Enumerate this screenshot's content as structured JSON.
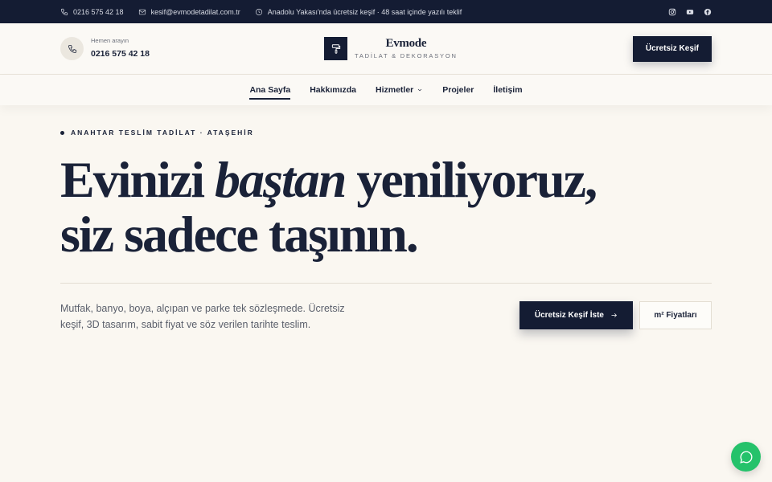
{
  "topbar": {
    "phone": "0216 575 42 18",
    "email": "kesif@evmodetadilat.com.tr",
    "notice": "Anadolu Yakası'nda ücretsiz keşif · 48 saat içinde yazılı teklif",
    "socials": [
      "instagram-icon",
      "youtube-icon",
      "facebook-icon"
    ]
  },
  "header": {
    "call_label": "Hemen arayın",
    "call_phone": "0216 575 42 18",
    "brand_name": "Evmode",
    "brand_sub": "TADİLAT & DEKORASYON",
    "cta": "Ücretsiz Keşif"
  },
  "nav": {
    "items": [
      "Ana Sayfa",
      "Hakkımızda",
      "Hizmetler",
      "Projeler",
      "İletişim"
    ],
    "active": "Ana Sayfa"
  },
  "hero": {
    "eyebrow": "ANAHTAR TESLİM TADİLAT · ATAŞEHİR",
    "headline_part1": "Evinizi ",
    "headline_em": "baştan",
    "headline_part2": " yeniliyoruz,",
    "headline_line2": "siz sadece taşının.",
    "lead": "Mutfak, banyo, boya, alçıpan ve parke tek sözleşmede. Ücretsiz keşif, 3D tasarım, sabit fiyat ve söz verilen tarihte teslim.",
    "primary_button": "Ücretsiz Keşif İste",
    "secondary_button": "m² Fiyatları"
  },
  "colors": {
    "navy": "#141c33",
    "background": "#faf7f1",
    "chat_green": "#25c26b"
  }
}
